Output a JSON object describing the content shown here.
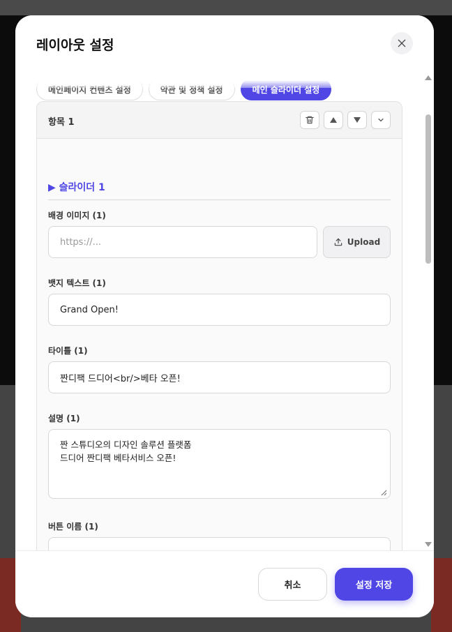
{
  "modal": {
    "title": "레이아웃 설정",
    "close_icon": "close-icon"
  },
  "tabs": [
    {
      "label": "메인페이지 컨텐츠 설정",
      "active": false
    },
    {
      "label": "약관 및 정책 설정",
      "active": false
    },
    {
      "label": "메인 슬라이더 설정",
      "active": true
    }
  ],
  "item": {
    "title": "항목 1",
    "actions": [
      "trash-icon",
      "arrow-up-icon",
      "arrow-down-icon",
      "chevron-down-icon"
    ]
  },
  "slider": {
    "section_title": "▶ 슬라이더 1",
    "bg_image": {
      "label": "배경 이미지 (1)",
      "placeholder": "https://...",
      "value": "",
      "upload_label": "Upload",
      "upload_icon": "upload-icon"
    },
    "badge": {
      "label": "뱃지 텍스트 (1)",
      "value": "Grand Open!"
    },
    "title_field": {
      "label": "타이틀 (1)",
      "value": "짠디팩 드디어<br/>베타 오픈!"
    },
    "description": {
      "label": "설명 (1)",
      "value": "짠 스튜디오의 디자인 솔루션 플랫폼\n드디어 짠디팩 베타서비스 오픈!"
    },
    "button_name": {
      "label": "버튼 이름 (1)"
    }
  },
  "footer": {
    "cancel_label": "취소",
    "save_label": "설정 저장"
  },
  "colors": {
    "accent": "#4f46e5"
  }
}
